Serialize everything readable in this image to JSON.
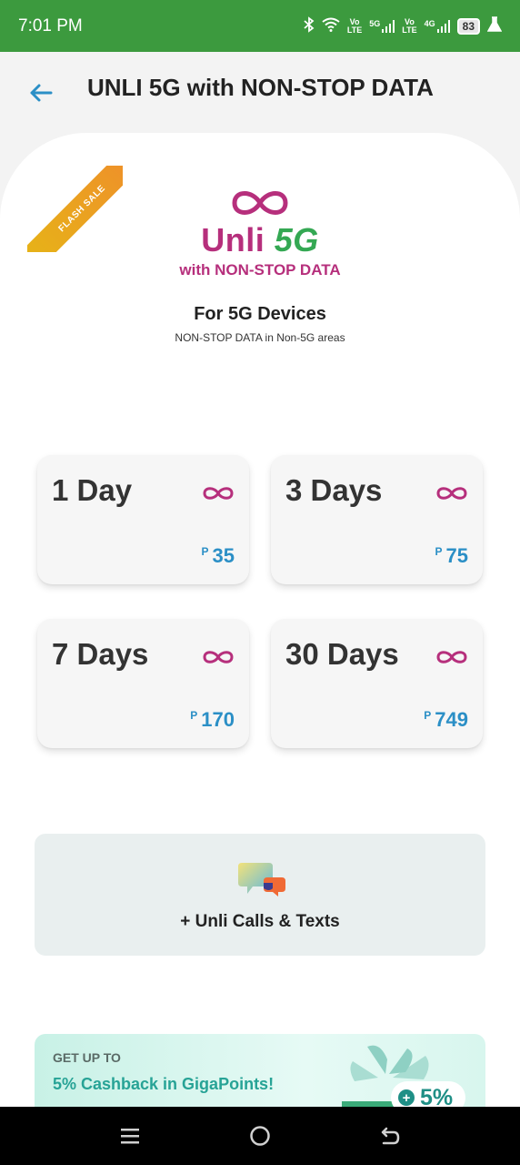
{
  "status_bar": {
    "time": "7:01 PM",
    "net1_top": "Vo",
    "net1_bottom": "LTE",
    "net2": "5G",
    "net3_top": "Vo",
    "net3_bottom": "LTE",
    "net4": "4G",
    "battery": "83"
  },
  "header": {
    "title": "UNLI 5G with NON-STOP DATA",
    "back_icon": "back-arrow-icon"
  },
  "promo": {
    "ribbon": "FLASH SALE",
    "logo_word": "Unli",
    "logo_5g": "5G",
    "logo_sub": "with NON-STOP DATA",
    "devices_title": "For 5G Devices",
    "devices_sub": "NON-STOP DATA in Non-5G areas"
  },
  "plans": [
    {
      "name": "1 Day",
      "currency": "P",
      "price": "35"
    },
    {
      "name": "3 Days",
      "currency": "P",
      "price": "75"
    },
    {
      "name": "7 Days",
      "currency": "P",
      "price": "170"
    },
    {
      "name": "30 Days",
      "currency": "P",
      "price": "749"
    }
  ],
  "calls": {
    "label": "+ Unli Calls & Texts",
    "icon": "chat-bubbles-icon"
  },
  "cashback": {
    "kicker": "GET UP TO",
    "title": "5% Cashback in GigaPoints!",
    "plus": "+",
    "percent": "5%"
  },
  "colors": {
    "status_green": "#3c9a3e",
    "brand_magenta": "#b62f7c",
    "price_blue": "#2b8fc6",
    "teal": "#1f8f86"
  }
}
